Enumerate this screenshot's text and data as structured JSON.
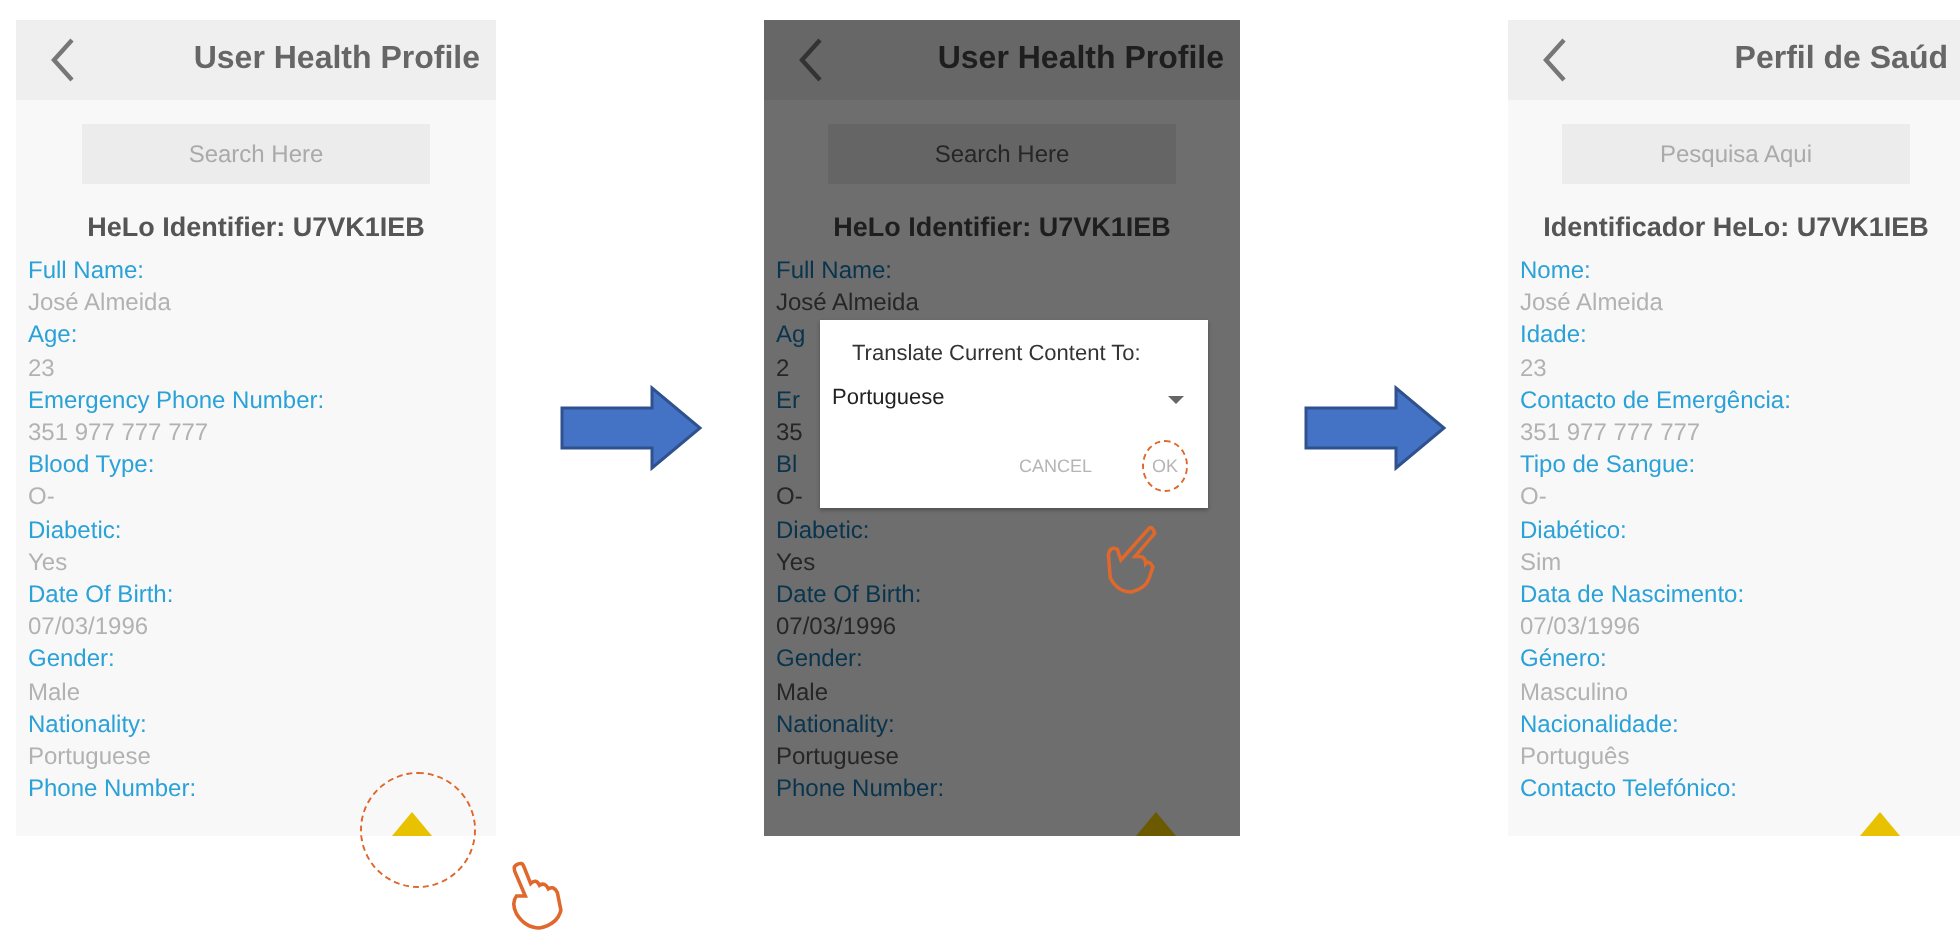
{
  "screens": [
    {
      "title": "User Health Profile",
      "search": {
        "placeholder": "Search Here"
      },
      "identifier": "HeLo Identifier: U7VK1IEB",
      "dimmed": false,
      "scroll_button_tapped": true,
      "fields": [
        {
          "label": "Full Name:",
          "value": "José Almeida"
        },
        {
          "label": "Age:",
          "value": "23"
        },
        {
          "label": "Emergency Phone Number:",
          "value": "351 977 777 777"
        },
        {
          "label": "Blood Type:",
          "value": "O-"
        },
        {
          "label": "Diabetic:",
          "value": "Yes"
        },
        {
          "label": "Date Of Birth:",
          "value": "07/03/1996"
        },
        {
          "label": "Gender:",
          "value": "Male"
        },
        {
          "label": "Nationality:",
          "value": "Portuguese"
        },
        {
          "label": "Phone Number:"
        }
      ]
    },
    {
      "title": "User Health Profile",
      "search": {
        "placeholder": "Search Here"
      },
      "identifier": "HeLo Identifier: U7VK1IEB",
      "dimmed": true,
      "fields": [
        {
          "label": "Full Name:",
          "value": "José Almeida"
        },
        {
          "label": "Ag",
          "value": "2"
        },
        {
          "label": "Er",
          "value": "35"
        },
        {
          "label": "Bl",
          "value": "O-"
        },
        {
          "label": "Diabetic:",
          "value": "Yes"
        },
        {
          "label": "Date Of Birth:",
          "value": "07/03/1996"
        },
        {
          "label": "Gender:",
          "value": "Male"
        },
        {
          "label": "Nationality:",
          "value": "Portuguese"
        },
        {
          "label": "Phone Number:"
        }
      ],
      "dialog": {
        "title": "Translate Current Content To:",
        "value": "Portuguese",
        "buttons": [
          "CANCEL",
          "OK"
        ],
        "ok_tapped": true
      }
    },
    {
      "title": "Perfil de Saúd",
      "search": {
        "placeholder": "Pesquisa Aqui"
      },
      "identifier": "Identificador HeLo: U7VK1IEB",
      "dimmed": false,
      "fields": [
        {
          "label": "Nome:",
          "value": "José Almeida"
        },
        {
          "label": "Idade:",
          "value": "23"
        },
        {
          "label": "Contacto de Emergência:",
          "value": "351 977 777 777"
        },
        {
          "label": "Tipo de Sangue:",
          "value": "O-"
        },
        {
          "label": "Diabético:",
          "value": "Sim"
        },
        {
          "label": "Data de Nascimento:",
          "value": "07/03/1996"
        },
        {
          "label": "Género:",
          "value": "Masculino"
        },
        {
          "label": "Nacionalidade:",
          "value": "Português"
        },
        {
          "label": "Contacto Telefónico:"
        }
      ]
    }
  ]
}
